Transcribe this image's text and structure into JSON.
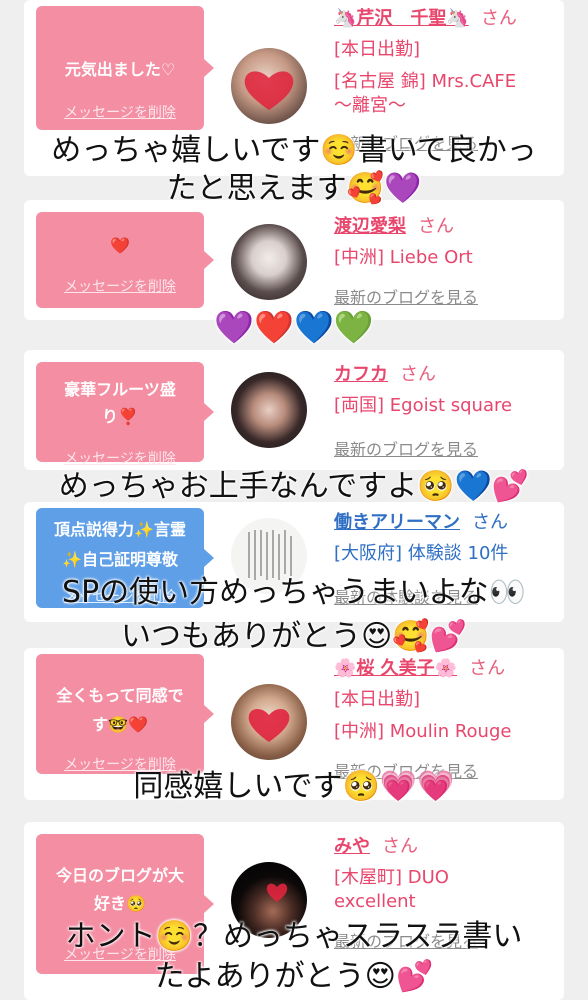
{
  "cards": [
    {
      "message": "元気出ました♡",
      "delete_label": "メッセージを削除",
      "name": "🦄芹沢　千聖🦄",
      "san": "さん",
      "lines": [
        "[本日出勤]",
        "[名古屋 錦] Mrs.CAFE",
        "〜離宮〜"
      ],
      "blog_link": "最新のブログを見る"
    },
    {
      "message": "❤️",
      "delete_label": "メッセージを削除",
      "name": "渡辺愛梨",
      "san": "さん",
      "lines": [
        "[中洲] Liebe Ort"
      ],
      "blog_link": "最新のブログを見る"
    },
    {
      "message_line1": "豪華フルーツ盛",
      "message_line2": "り❣️",
      "delete_label": "メッセージを削除",
      "name": "カフカ",
      "san": "さん",
      "lines": [
        "[両国] Egoist square"
      ],
      "blog_link": "最新のブログを見る"
    },
    {
      "message_line1": "頂点説得力✨言霊",
      "message_line2": "✨自己証明尊敬",
      "delete_label": "メッセージを削除",
      "name": "働きアリーマン",
      "san": "さん",
      "lines": [
        "[大阪府] 体験談 10件"
      ],
      "blog_link": "最新の体験談を見る"
    },
    {
      "message_line1": "全くもって同感で",
      "message_line2": "す🤓❤️",
      "delete_label": "メッセージを削除",
      "name": "🌸桜 久美子🌸",
      "san": "さん",
      "lines": [
        "[本日出勤]",
        "[中洲] Moulin Rouge"
      ],
      "blog_link": "最新のブログを見る"
    },
    {
      "message_line1": "今日のブログが大",
      "message_line2": "好き🥺",
      "delete_label": "メッセージを削除",
      "name": "みや",
      "san": "さん",
      "lines": [
        "[木屋町] DUO",
        "excellent"
      ],
      "blog_link": "最新のブログを見る"
    }
  ],
  "overlays": {
    "o1_line1": "めっちゃ嬉しいです☺️書いて良かっ",
    "o1_line2": "たと思えます🥰💜",
    "o2": "💜❤️💙💚",
    "o3": "めっちゃお上手なんですよ🥺💙💕",
    "o4_line1": "SPの使い方めっちゃうまいよな👀",
    "o4_line2": "いつもありがとう😍🥰💕",
    "o5": "同感嬉しいです🥺💗💗",
    "o6_line1": "ホント☺️？めっちゃスラスラ書い",
    "o6_line2": "たよありがとう😍💕"
  },
  "colors": {
    "bubble_pink": "#f48ea3",
    "bubble_blue": "#5e9fe7",
    "name_pink": "#e8466c",
    "name_blue": "#2f6fc4",
    "link_gray": "#8a8a8a",
    "background": "#efefef"
  }
}
